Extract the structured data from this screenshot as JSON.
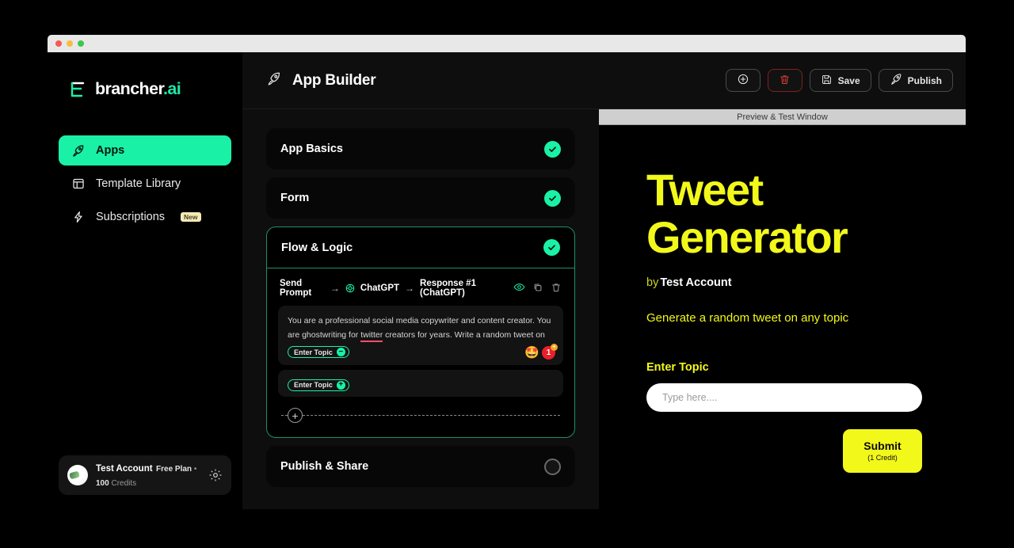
{
  "window": {
    "traffic_lights": [
      "close-red",
      "minimize-yellow",
      "maximize-green"
    ]
  },
  "sidebar": {
    "logo_text": "brancher",
    "logo_suffix": ".ai",
    "items": [
      {
        "label": "Apps",
        "icon": "rocket-icon",
        "active": true,
        "badge": ""
      },
      {
        "label": "Template Library",
        "icon": "layout-icon",
        "active": false,
        "badge": ""
      },
      {
        "label": "Subscriptions",
        "icon": "bolt-icon",
        "active": false,
        "badge": "New"
      }
    ],
    "account": {
      "name": "Test Account",
      "plan": "Free Plan",
      "separator": "•",
      "credits": "100",
      "credits_label": "Credits",
      "settings_icon": "gear-icon"
    }
  },
  "header": {
    "title": "App Builder",
    "title_icon": "rocket-icon",
    "buttons": [
      {
        "label": "",
        "icon": "plus-circle-icon",
        "name": "add-button"
      },
      {
        "label": "",
        "icon": "trash-icon",
        "name": "delete-button"
      },
      {
        "label": "Save",
        "icon": "floppy-disk-icon",
        "name": "save-button"
      },
      {
        "label": "Publish",
        "icon": "rocket-icon",
        "name": "publish-button"
      }
    ]
  },
  "builder": {
    "sections": [
      {
        "label": "App Basics",
        "status": "complete"
      },
      {
        "label": "Form",
        "status": "complete"
      },
      {
        "label": "Flow & Logic",
        "status": "complete"
      },
      {
        "label": "Publish & Share",
        "status": "incomplete"
      }
    ],
    "flow": {
      "node": {
        "step": "Send Prompt",
        "arrow": "→",
        "model": "ChatGPT",
        "model_icon": "openai-icon",
        "output": "Response #1 (ChatGPT)",
        "actions": [
          "eye-icon",
          "copy-icon",
          "trash-icon"
        ]
      },
      "prompt": {
        "text_part1": "You are a professional social media copywriter and content creator. You are ghostwriting for ",
        "misspelled_word": "twitter",
        "text_part2": " creators for years. Write a random tweet on",
        "chip_label": "Enter Topic",
        "chip_action": "−",
        "emoji": "🤩",
        "count_badge": "1",
        "count_badge_plus": "+"
      },
      "prompt_second": {
        "chip_label": "Enter Topic",
        "chip_action": "+"
      },
      "add_node_icon": "plus-circle-icon"
    }
  },
  "preview": {
    "bar_title": "Preview & Test Window",
    "app_title": "Tweet Generator",
    "by_prefix": "by",
    "author": "Test Account",
    "description": "Generate a random tweet on any topic",
    "field_label": "Enter Topic",
    "input_value": "",
    "input_placeholder": "Type here....",
    "submit_label": "Submit",
    "submit_sub": "(1 Credit)"
  },
  "colors": {
    "accent_green": "#19f2a6",
    "accent_yellow": "#f2f81a",
    "danger_red": "#e2403a",
    "panel_dark": "#0e0e0e"
  }
}
